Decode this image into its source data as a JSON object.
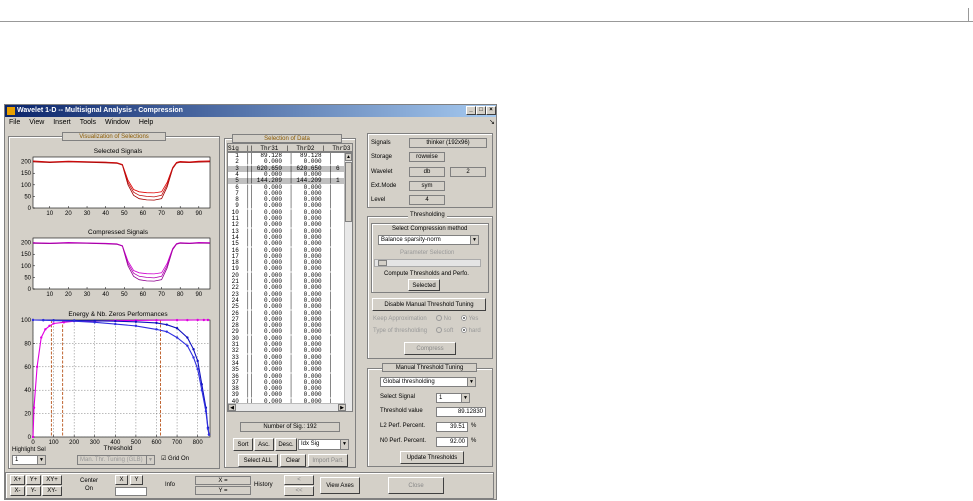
{
  "window": {
    "title": "Wavelet 1-D  --  Multisignal Analysis - Compression",
    "menu": [
      "File",
      "View",
      "Insert",
      "Tools",
      "Window",
      "Help"
    ]
  },
  "visualization": {
    "panel_title": "Visualization of Selections",
    "plot1": {
      "title": "Selected Signals"
    },
    "plot2": {
      "title": "Compressed Signals"
    },
    "plot3": {
      "title": "Energy & Nb. Zeros Performances",
      "xlabel": "Threshold"
    }
  },
  "chart_data": [
    {
      "type": "line",
      "title": "Selected Signals",
      "xlabel": "",
      "ylabel": "",
      "xlim": [
        1,
        96
      ],
      "ylim": [
        0,
        220
      ],
      "xticks": [
        10,
        20,
        30,
        40,
        50,
        60,
        70,
        80,
        90
      ],
      "yticks": [
        0,
        50,
        100,
        150,
        200
      ],
      "grid": false,
      "series": [
        {
          "color": "#e00000",
          "x": [
            1,
            10,
            20,
            30,
            40,
            46,
            49,
            52,
            55,
            58,
            62,
            66,
            70,
            73,
            76,
            78,
            80,
            85,
            90,
            96
          ],
          "y": [
            203,
            199,
            202,
            200,
            198,
            196,
            188,
            120,
            80,
            70,
            66,
            65,
            70,
            110,
            175,
            197,
            201,
            199,
            202,
            203
          ]
        },
        {
          "color": "#a00000",
          "x": [
            1,
            10,
            20,
            30,
            40,
            46,
            49,
            52,
            55,
            58,
            62,
            66,
            70,
            73,
            76,
            78,
            80,
            85,
            90,
            96
          ],
          "y": [
            199,
            196,
            199,
            197,
            195,
            193,
            185,
            100,
            55,
            40,
            35,
            34,
            40,
            90,
            170,
            193,
            197,
            196,
            198,
            199
          ]
        },
        {
          "color": "#c01010",
          "x": [
            1,
            10,
            20,
            30,
            40,
            46,
            49,
            52,
            55,
            58,
            62,
            66,
            70,
            73,
            76,
            78,
            80,
            85,
            90,
            96
          ],
          "y": [
            201,
            198,
            200,
            199,
            197,
            194,
            186,
            110,
            68,
            55,
            50,
            48,
            55,
            100,
            172,
            195,
            199,
            197,
            200,
            201
          ]
        }
      ]
    },
    {
      "type": "line",
      "title": "Compressed Signals",
      "xlabel": "",
      "ylabel": "",
      "xlim": [
        1,
        96
      ],
      "ylim": [
        0,
        220
      ],
      "xticks": [
        10,
        20,
        30,
        40,
        50,
        60,
        70,
        80,
        90
      ],
      "yticks": [
        0,
        50,
        100,
        150,
        200
      ],
      "grid": false,
      "series": [
        {
          "color": "#d000d0",
          "x": [
            1,
            10,
            20,
            30,
            40,
            46,
            49,
            52,
            55,
            58,
            62,
            66,
            70,
            73,
            76,
            78,
            80,
            85,
            90,
            96
          ],
          "y": [
            200,
            198,
            201,
            199,
            197,
            195,
            187,
            120,
            80,
            70,
            66,
            65,
            70,
            110,
            175,
            196,
            200,
            198,
            201,
            200
          ]
        },
        {
          "color": "#900090",
          "x": [
            1,
            10,
            20,
            30,
            40,
            46,
            49,
            52,
            55,
            58,
            62,
            66,
            70,
            73,
            76,
            78,
            80,
            85,
            90,
            96
          ],
          "y": [
            197,
            196,
            198,
            197,
            195,
            193,
            185,
            100,
            55,
            40,
            35,
            34,
            40,
            90,
            170,
            193,
            197,
            196,
            198,
            197
          ]
        },
        {
          "color": "#b000b0",
          "x": [
            1,
            10,
            20,
            30,
            40,
            46,
            49,
            52,
            55,
            58,
            62,
            66,
            70,
            73,
            76,
            78,
            80,
            85,
            90,
            96
          ],
          "y": [
            199,
            197,
            199,
            198,
            196,
            194,
            186,
            110,
            68,
            55,
            50,
            48,
            55,
            100,
            172,
            195,
            199,
            197,
            199,
            199
          ]
        }
      ]
    },
    {
      "type": "line",
      "title": "Energy & Nb. Zeros Performances",
      "xlabel": "Threshold",
      "ylabel": "",
      "xlim": [
        0,
        860
      ],
      "ylim": [
        0,
        100
      ],
      "xticks": [
        0,
        100,
        200,
        300,
        400,
        500,
        600,
        700,
        800
      ],
      "yticks": [
        0,
        20,
        40,
        60,
        80,
        100
      ],
      "grid": true,
      "series": [
        {
          "color": "#e000e0",
          "x": [
            0,
            5,
            20,
            40,
            60,
            80,
            100,
            150,
            200,
            300,
            400,
            500,
            600,
            700,
            750,
            800,
            830,
            850
          ],
          "y": [
            0,
            25,
            60,
            85,
            92,
            95,
            97,
            98,
            99,
            99,
            99.5,
            99.7,
            99.8,
            99.9,
            99.9,
            100,
            100,
            100
          ]
        },
        {
          "color": "#1010c0",
          "x": [
            0,
            50,
            100,
            200,
            300,
            400,
            500,
            600,
            650,
            700,
            750,
            780,
            800,
            820,
            840,
            850,
            855
          ],
          "y": [
            100,
            99.9,
            99.8,
            99.6,
            99.3,
            99,
            98.5,
            97.5,
            96,
            93,
            85,
            75,
            65,
            45,
            25,
            8,
            2
          ]
        },
        {
          "color": "#3030e0",
          "x": [
            0,
            50,
            100,
            200,
            300,
            400,
            500,
            600,
            650,
            700,
            750,
            780,
            800,
            820,
            840,
            850,
            855
          ],
          "y": [
            100,
            99.8,
            99.5,
            99,
            98,
            96.5,
            95,
            92,
            90,
            85,
            78,
            68,
            58,
            40,
            22,
            7,
            2
          ]
        }
      ],
      "markers": {
        "threshold_lines_x": [
          89.1283,
          144.209,
          620
        ]
      }
    }
  ],
  "highlight": {
    "label": "Highlight Sel",
    "value": "1"
  },
  "tuning_mode": {
    "label": "Man. Thr. Tuning (GLB)"
  },
  "grid_on": {
    "label": "Grid On"
  },
  "nav": {
    "xp": "X+",
    "yp": "Y+",
    "xyp": "XY+",
    "xm": "X-",
    "ym": "Y-",
    "xym": "XY-",
    "center_on": "Center\nOn",
    "x": "X",
    "y": "Y",
    "info": "Info",
    "x_eq": "X =",
    "y_eq": "Y =",
    "history": "History",
    "view_axes": "View Axes",
    "close": "Close"
  },
  "selection": {
    "panel_title": "Selection of Data",
    "header": "Sig  ||  Thr31  |  ThrD2  |  ThrD3  |",
    "rows": [
      "  1  ||  89.128  |  89.128  |",
      "  2  ||   0.000  |   0.000  |",
      "  3  || 620.650  | 620.650  | 6",
      "  4  ||   0.000  |   0.000  |",
      "  5  || 144.209  | 144.209  | 1",
      "  6  ||   0.000  |   0.000  |",
      "  7  ||   0.000  |   0.000  |",
      "  8  ||   0.000  |   0.000  |",
      "  9  ||   0.000  |   0.000  |",
      " 10  ||   0.000  |   0.000  |",
      " 11  ||   0.000  |   0.000  |",
      " 12  ||   0.000  |   0.000  |",
      " 13  ||   0.000  |   0.000  |",
      " 14  ||   0.000  |   0.000  |",
      " 15  ||   0.000  |   0.000  |",
      " 16  ||   0.000  |   0.000  |",
      " 17  ||   0.000  |   0.000  |",
      " 18  ||   0.000  |   0.000  |",
      " 19  ||   0.000  |   0.000  |",
      " 20  ||   0.000  |   0.000  |",
      " 21  ||   0.000  |   0.000  |",
      " 22  ||   0.000  |   0.000  |",
      " 23  ||   0.000  |   0.000  |",
      " 24  ||   0.000  |   0.000  |",
      " 25  ||   0.000  |   0.000  |",
      " 26  ||   0.000  |   0.000  |",
      " 27  ||   0.000  |   0.000  |",
      " 28  ||   0.000  |   0.000  |",
      " 29  ||   0.000  |   0.000  |",
      " 30  ||   0.000  |   0.000  |",
      " 31  ||   0.000  |   0.000  |",
      " 32  ||   0.000  |   0.000  |",
      " 33  ||   0.000  |   0.000  |",
      " 34  ||   0.000  |   0.000  |",
      " 35  ||   0.000  |   0.000  |",
      " 36  ||   0.000  |   0.000  |",
      " 37  ||   0.000  |   0.000  |",
      " 38  ||   0.000  |   0.000  |",
      " 39  ||   0.000  |   0.000  |",
      " 40  ||   0.000  |   0.000  |"
    ],
    "highlighted_rows": [
      2,
      4
    ],
    "count_label": "Number of Sig.: 192",
    "sort": "Sort",
    "asc": "Asc.",
    "desc": "Desc.",
    "sort_by": "Idx Sig",
    "select_all": "Select ALL",
    "clear": "Clear",
    "import_part": "Import Part."
  },
  "info": {
    "signals_label": "Signals",
    "signals_value": "thinker (192x96)",
    "storage_label": "Storage",
    "storage_value": "rowwise",
    "wavelet_label": "Wavelet",
    "wavelet_value": "db",
    "wavelet_num": "2",
    "extmode_label": "Ext.Mode",
    "extmode_value": "sym",
    "level_label": "Level",
    "level_value": "4"
  },
  "thresholding": {
    "title": "Thresholding",
    "method_label": "Select Compression method",
    "method_value": "Balance sparsity-norm",
    "param_label": "Parameter Selection",
    "compute_label": "Compute Thresholds and Perfo.",
    "selected_btn": "Selected",
    "disable_btn": "Disable Manual Threshold Tuning",
    "keep_approx": "Keep Approximation",
    "keep_no": "No",
    "keep_yes": "Yes",
    "type_thr": "Type of thresholding",
    "soft": "soft",
    "hard": "hard",
    "compress_btn": "Compress"
  },
  "manual": {
    "title": "Manual Threshold Tuning",
    "mode_value": "Global thresholding",
    "select_signal_label": "Select Signal",
    "select_signal_value": "1",
    "threshold_label": "Threshold value",
    "threshold_value": "89.12830",
    "l2_label": "L2 Perf. Percent.",
    "l2_value": "39.51",
    "l2_unit": "%",
    "n0_label": "N0 Perf. Percent.",
    "n0_value": "92.00",
    "n0_unit": "%",
    "update_btn": "Update Thresholds"
  }
}
